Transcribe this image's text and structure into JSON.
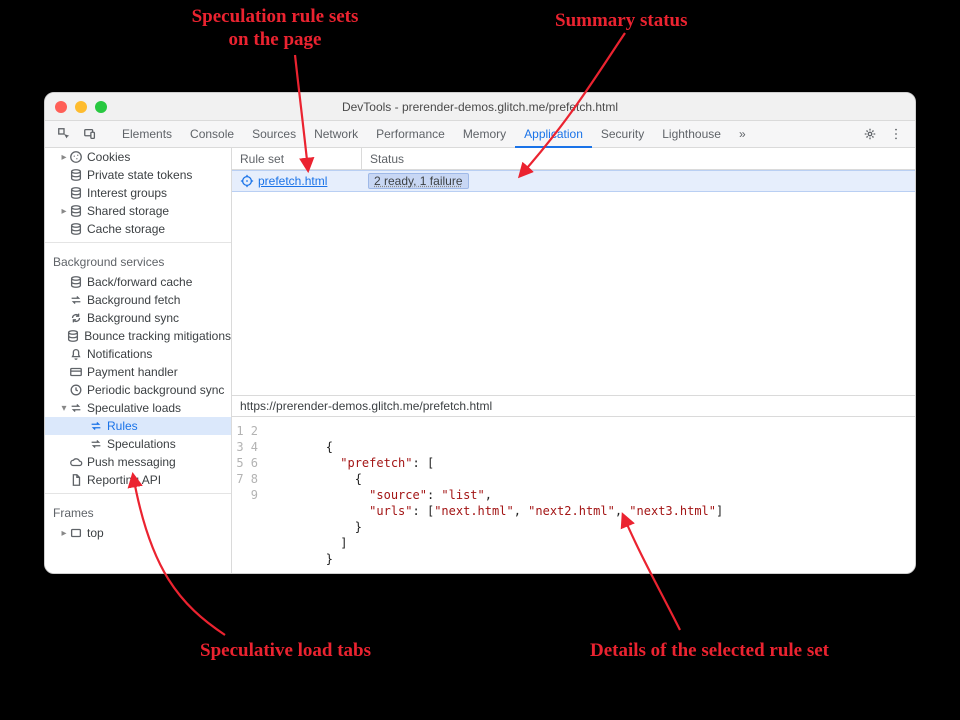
{
  "annotations": {
    "rule_sets": "Speculation rule sets\non the page",
    "summary": "Summary status",
    "tabs": "Speculative load tabs",
    "details": "Details of the selected rule set"
  },
  "window": {
    "title": "DevTools - prerender-demos.glitch.me/prefetch.html"
  },
  "tabs": {
    "items": [
      "Elements",
      "Console",
      "Sources",
      "Network",
      "Performance",
      "Memory",
      "Application",
      "Security",
      "Lighthouse"
    ],
    "active": "Application",
    "more": "»"
  },
  "sidebar": {
    "storage_items": [
      {
        "label": "Cookies",
        "icon": "cookie",
        "expandable": true
      },
      {
        "label": "Private state tokens",
        "icon": "db"
      },
      {
        "label": "Interest groups",
        "icon": "db"
      },
      {
        "label": "Shared storage",
        "icon": "db",
        "expandable": true
      },
      {
        "label": "Cache storage",
        "icon": "db"
      }
    ],
    "bg_header": "Background services",
    "bg_items": [
      {
        "label": "Back/forward cache",
        "icon": "db"
      },
      {
        "label": "Background fetch",
        "icon": "arrows"
      },
      {
        "label": "Background sync",
        "icon": "sync"
      },
      {
        "label": "Bounce tracking mitigations",
        "icon": "db"
      },
      {
        "label": "Notifications",
        "icon": "bell"
      },
      {
        "label": "Payment handler",
        "icon": "card"
      },
      {
        "label": "Periodic background sync",
        "icon": "clock"
      },
      {
        "label": "Speculative loads",
        "icon": "arrows",
        "expanded": true
      }
    ],
    "spec_children": [
      {
        "label": "Rules",
        "icon": "arrows",
        "selected": true
      },
      {
        "label": "Speculations",
        "icon": "arrows"
      }
    ],
    "bg_tail": [
      {
        "label": "Push messaging",
        "icon": "cloud"
      },
      {
        "label": "Reporting API",
        "icon": "doc"
      }
    ],
    "frames_header": "Frames",
    "frames_items": [
      {
        "label": "top",
        "icon": "frame",
        "expandable": true
      }
    ]
  },
  "ruleset_table": {
    "headers": {
      "ruleset": "Rule set",
      "status": "Status"
    },
    "rows": [
      {
        "ruleset": "prefetch.html",
        "status": "2 ready, 1 failure"
      }
    ]
  },
  "url_bar": {
    "url": "https://prerender-demos.glitch.me/prefetch.html"
  },
  "code": {
    "lines": [
      "",
      "{",
      "  \"prefetch\": [",
      "    {",
      "      \"source\": \"list\",",
      "      \"urls\": [\"next.html\", \"next2.html\", \"next3.html\"]",
      "    }",
      "  ]",
      "}"
    ]
  }
}
